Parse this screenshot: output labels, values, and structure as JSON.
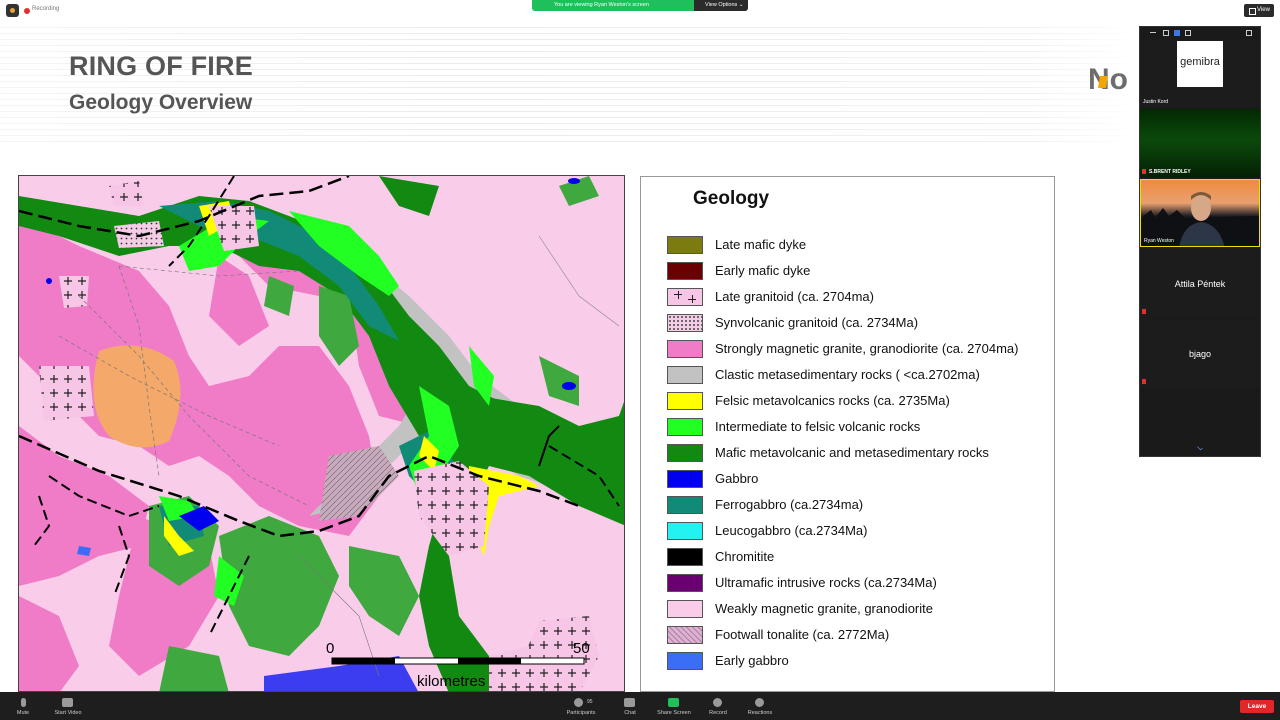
{
  "topbar": {
    "recording_label": "Recording",
    "share_banner": "You are viewing Ryan Weston's screen",
    "view_options": "View Options",
    "view_button": "View"
  },
  "slide": {
    "title": "RING OF FIRE",
    "subtitle": "Geology Overview",
    "logo_text": "No",
    "map": {
      "scale_start": "0",
      "scale_end": "50",
      "scale_unit": "kilometres"
    },
    "legend": {
      "title": "Geology",
      "items": [
        {
          "label": "Late mafic dyke",
          "color": "#7b7b10"
        },
        {
          "label": "Early mafic dyke",
          "color": "#6b0000"
        },
        {
          "label": "Late granitoid (ca. 2704ma)",
          "color": "#f7c5e6",
          "pattern": "cross"
        },
        {
          "label": "Synvolcanic granitoid (ca. 2734Ma)",
          "color": "#f4cce6",
          "pattern": "dots"
        },
        {
          "label": "Strongly magnetic granite, granodiorite (ca. 2704ma)",
          "color": "#f07cc8"
        },
        {
          "label": "Clastic metasedimentary rocks ( <ca.2702ma)",
          "color": "#c2c2c2"
        },
        {
          "label": "Felsic metavolcanics rocks (ca. 2735Ma)",
          "color": "#ffff00"
        },
        {
          "label": "Intermediate to felsic volcanic rocks",
          "color": "#22ff22"
        },
        {
          "label": "Mafic metavolcanic and metasedimentary rocks",
          "color": "#128a12"
        },
        {
          "label": "Gabbro",
          "color": "#0000ee"
        },
        {
          "label": "Ferrogabbro (ca.2734ma)",
          "color": "#128a78"
        },
        {
          "label": "Leucogabbro (ca.2734Ma)",
          "color": "#22f2f2"
        },
        {
          "label": "Chromitite",
          "color": "#000000"
        },
        {
          "label": "Ultramafic intrusive rocks (ca.2734Ma)",
          "color": "#6a0070"
        },
        {
          "label": "Weakly magnetic granite, granodiorite",
          "color": "#f9cdea"
        },
        {
          "label": "Footwall tonalite (ca. 2772Ma)",
          "color": "#e0b0d4",
          "pattern": "hatch"
        },
        {
          "label": "Early gabbro",
          "color": "#3c6ef5"
        }
      ]
    }
  },
  "participants": [
    {
      "name": "Justin Kord",
      "tile_text": "gemibra"
    },
    {
      "name": "S.BRENT RIDLEY"
    },
    {
      "name": "Ryan Weston"
    },
    {
      "name": "Attila Péntek"
    },
    {
      "name": "bjago"
    }
  ],
  "toolbar": {
    "mute": "Mute",
    "start_video": "Start Video",
    "participants": "Participants",
    "participants_count": "95",
    "chat": "Chat",
    "share_screen": "Share Screen",
    "record": "Record",
    "reactions": "Reactions",
    "leave": "Leave"
  }
}
